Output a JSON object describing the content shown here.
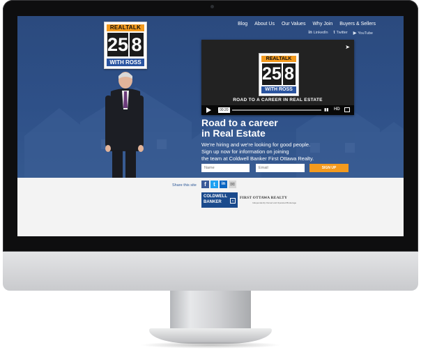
{
  "logo": {
    "top": "REALTALK",
    "digits": [
      "25",
      "8"
    ],
    "bottom": "WITH ROSS"
  },
  "nav": {
    "items": [
      "Blog",
      "About Us",
      "Our Values",
      "Why Join",
      "Buyers & Sellers"
    ]
  },
  "social_links": [
    {
      "icon": "linkedin-icon",
      "glyph": "in",
      "label": "LinkedIn"
    },
    {
      "icon": "twitter-icon",
      "glyph": "t",
      "label": "Twitter"
    },
    {
      "icon": "youtube-icon",
      "glyph": "▶",
      "label": "YouTube"
    }
  ],
  "video": {
    "title": "ROAD TO A CAREER IN REAL ESTATE",
    "time": "00:20",
    "hd": "HD",
    "logo": {
      "top": "REALTALK",
      "digits": [
        "25",
        "8"
      ],
      "bottom": "WITH ROSS"
    }
  },
  "hero": {
    "headline": [
      "Road to a career",
      "in Real Estate"
    ],
    "body": [
      "We're hiring and we're looking for good people.",
      "Sign up now for information on joining",
      "the team at Coldwell Banker First Ottawa Realty."
    ]
  },
  "form": {
    "name_placeholder": "Name",
    "email_placeholder": "Email",
    "submit_label": "SIGN UP"
  },
  "share": {
    "label": "Share this site",
    "icons": [
      {
        "name": "facebook-icon",
        "glyph": "f",
        "color": "#3b5998"
      },
      {
        "name": "twitter-icon",
        "glyph": "t",
        "color": "#1da1f2"
      },
      {
        "name": "linkedin-icon",
        "glyph": "in",
        "color": "#0a66c2"
      },
      {
        "name": "email-icon",
        "glyph": "✉",
        "color": "#d6d6d6"
      }
    ]
  },
  "partners": {
    "coldwell": [
      "COLDWELL",
      "BANKER"
    ],
    "first_ottawa": "FIRST OTTAWA REALTY",
    "first_ottawa_sub": "Independently Owned and Operated Brokerage"
  },
  "colors": {
    "accent": "#f39a1e",
    "hero_blue": "#2e5088",
    "brand_blue": "#1a4a8c"
  }
}
